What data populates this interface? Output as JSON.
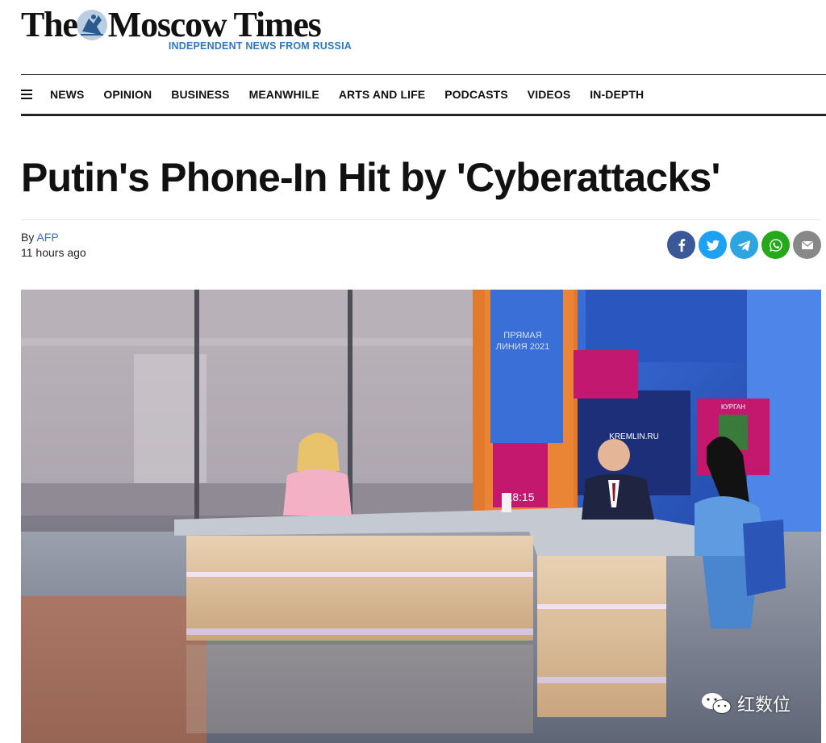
{
  "masthead": {
    "title_part1": "The",
    "title_part2": "Moscow Times",
    "tagline": "INDEPENDENT NEWS FROM RUSSIA",
    "tagline_color": "#2b78c5"
  },
  "nav": {
    "menu_icon": "hamburger-icon",
    "items": [
      {
        "label": "NEWS"
      },
      {
        "label": "OPINION"
      },
      {
        "label": "BUSINESS"
      },
      {
        "label": "MEANWHILE"
      },
      {
        "label": "ARTS AND LIFE"
      },
      {
        "label": "PODCASTS"
      },
      {
        "label": "VIDEOS"
      },
      {
        "label": "IN-DEPTH"
      }
    ]
  },
  "article": {
    "headline": "Putin's Phone-In Hit by 'Cyberattacks'",
    "byline_prefix": "By",
    "author": "AFP",
    "timestamp": "11 hours ago"
  },
  "share": [
    {
      "icon": "facebook-icon",
      "color": "#3b5998"
    },
    {
      "icon": "twitter-icon",
      "color": "#1da1f2"
    },
    {
      "icon": "telegram-icon",
      "color": "#2ca5e0"
    },
    {
      "icon": "whatsapp-icon",
      "color": "#25a81a"
    },
    {
      "icon": "email-icon",
      "color": "#888888"
    }
  ],
  "photo": {
    "screen_text_1": "ПРЯМАЯ ЛИНИЯ 2021",
    "screen_text_2": "KREMLIN.RU",
    "screen_text_3": "КУРГАН",
    "screen_text_4": "18:15"
  },
  "watermark": {
    "text": "红数位"
  }
}
